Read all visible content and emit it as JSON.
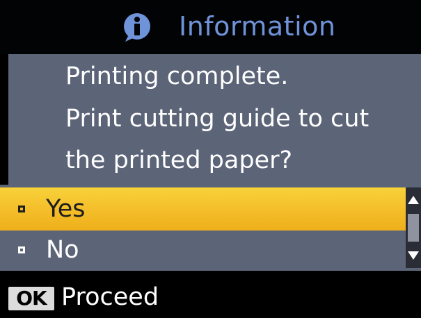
{
  "dialog": {
    "title": "Information",
    "title_icon": "info-icon",
    "message_lines": [
      "Printing complete.",
      "Print cutting guide to cut",
      "the printed paper?"
    ]
  },
  "options": [
    {
      "label": "Yes",
      "selected": true
    },
    {
      "label": "No",
      "selected": false
    }
  ],
  "footer": {
    "key_label": "OK",
    "action_label": "Proceed"
  },
  "colors": {
    "title_text": "#6f93d9",
    "panel_background": "#5c6478",
    "selection_highlight": "#f4bf2a",
    "text": "#ffffff"
  }
}
